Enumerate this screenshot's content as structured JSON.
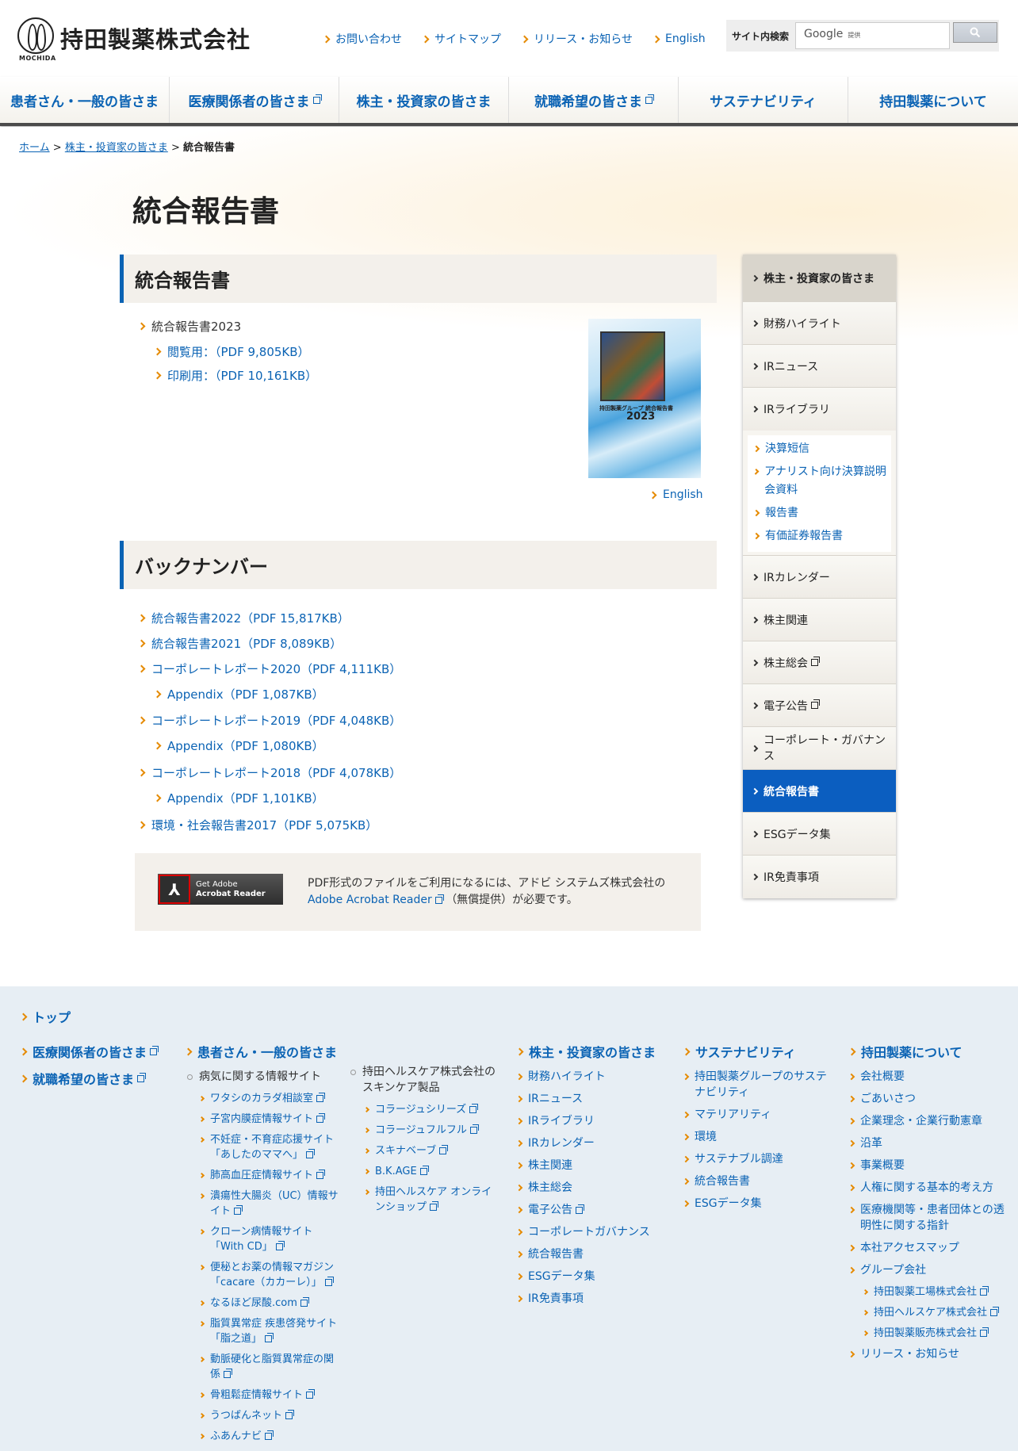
{
  "header": {
    "logo_name": "持田製薬株式会社",
    "logo_sub": "MOCHIDA",
    "links": [
      "お問い合わせ",
      "サイトマップ",
      "リリース・お知らせ",
      "English"
    ],
    "search_label": "サイト内検索",
    "search_placeholder": "Google",
    "search_suffix": "提供"
  },
  "gnav": [
    {
      "label": "患者さん・一般の皆さま",
      "ext": false
    },
    {
      "label": "医療関係者の皆さま",
      "ext": true
    },
    {
      "label": "株主・投資家の皆さま",
      "ext": false
    },
    {
      "label": "就職希望の皆さま",
      "ext": true
    },
    {
      "label": "サステナビリティ",
      "ext": false
    },
    {
      "label": "持田製薬について",
      "ext": false
    }
  ],
  "breadcrumb": {
    "home": "ホーム",
    "parent": "株主・投資家の皆さま",
    "sep": ">",
    "current": "統合報告書"
  },
  "page_title": "統合報告書",
  "section1": {
    "heading": "統合報告書",
    "item": "統合報告書2023",
    "links": [
      "閲覧用：（PDF 9,805KB）",
      "印刷用：（PDF 10,161KB）"
    ],
    "cover_title": "持田製薬グループ 統合報告書",
    "cover_year": "2023",
    "english": "English"
  },
  "section2": {
    "heading": "バックナンバー",
    "items": [
      {
        "label": "統合報告書2022（PDF 15,817KB）",
        "level": 0
      },
      {
        "label": "統合報告書2021（PDF 8,089KB）",
        "level": 0
      },
      {
        "label": "コーポレートレポート2020（PDF 4,111KB）",
        "level": 0
      },
      {
        "label": "Appendix（PDF 1,087KB）",
        "level": 1
      },
      {
        "label": "コーポレートレポート2019（PDF 4,048KB）",
        "level": 0
      },
      {
        "label": "Appendix（PDF 1,080KB）",
        "level": 1
      },
      {
        "label": "コーポレートレポート2018（PDF 4,078KB）",
        "level": 0
      },
      {
        "label": "Appendix（PDF 1,101KB）",
        "level": 1
      },
      {
        "label": "環境・社会報告書2017（PDF 5,075KB）",
        "level": 0
      }
    ]
  },
  "pdf_notice": {
    "badge_line1": "Get Adobe",
    "badge_line2": "Acrobat Reader",
    "text_before": "PDF形式のファイルをご利用になるには、アドビ システムズ株式会社の",
    "link": "Adobe Acrobat Reader",
    "text_after": "（無償提供）が必要です。"
  },
  "sidebar": {
    "top": "株主・投資家の皆さま",
    "items_before": [
      "財務ハイライト",
      "IRニュース",
      "IRライブラリ"
    ],
    "sub": [
      "決算短信",
      "アナリスト向け決算説明会資料",
      "報告書",
      "有価証券報告書"
    ],
    "items_after": [
      {
        "label": "IRカレンダー",
        "ext": false,
        "active": false
      },
      {
        "label": "株主関連",
        "ext": false,
        "active": false
      },
      {
        "label": "株主総会",
        "ext": true,
        "active": false
      },
      {
        "label": "電子公告",
        "ext": true,
        "active": false
      },
      {
        "label": "コーポレート・ガバナンス",
        "ext": false,
        "active": false
      },
      {
        "label": "統合報告書",
        "ext": false,
        "active": true
      },
      {
        "label": "ESGデータ集",
        "ext": false,
        "active": false
      },
      {
        "label": "IR免責事項",
        "ext": false,
        "active": false
      }
    ]
  },
  "footer": {
    "top": "トップ",
    "col1": [
      "医療関係者の皆さま",
      "就職希望の皆さま"
    ],
    "col2_head": "患者さん・一般の皆さま",
    "col2_group": "病気に関する情報サイト",
    "col2_items": [
      "ワタシのカラダ相談室",
      "子宮内膜症情報サイト",
      "不妊症・不育症応援サイト「あしたのママへ」",
      "肺高血圧症情報サイト",
      "潰瘍性大腸炎（UC）情報サイト",
      "クローン病情報サイト「With CD」",
      "便秘とお薬の情報マガジン「cacare（カカーレ）」",
      "なるほど尿酸.com",
      "脂質異常症 疾患啓発サイト「脂之道」",
      "動脈硬化と脂質異常症の関係",
      "骨粗鬆症情報サイト",
      "うつばんネット",
      "ふあんナビ"
    ],
    "col3_group": "持田ヘルスケア株式会社のスキンケア製品",
    "col3_items": [
      "コラージュシリーズ",
      "コラージュフルフル",
      "スキナベーブ",
      "B.K.AGE",
      "持田ヘルスケア オンラインショップ"
    ],
    "col4_head": "株主・投資家の皆さま",
    "col4_items": [
      "財務ハイライト",
      "IRニュース",
      "IRライブラリ",
      "IRカレンダー",
      "株主関連",
      "株主総会",
      "電子公告",
      "コーポレートガバナンス",
      "統合報告書",
      "ESGデータ集",
      "IR免責事項"
    ],
    "col5_head": "サステナビリティ",
    "col5_items": [
      "持田製薬グループのサステナビリティ",
      "マテリアリティ",
      "環境",
      "サステナブル調達",
      "統合報告書",
      "ESGデータ集"
    ],
    "col6_head": "持田製薬について",
    "col6_items": [
      "会社概要",
      "ごあいさつ",
      "企業理念・企業行動憲章",
      "沿革",
      "事業概要",
      "人権に関する基本的考え方",
      "医療機関等・患者団体との透明性に関する指針",
      "本社アクセスマップ",
      "グループ会社"
    ],
    "col6_sub": [
      "持田製薬工場株式会社",
      "持田ヘルスケア株式会社",
      "持田製薬販売株式会社"
    ],
    "col6_last": "リリース・お知らせ"
  }
}
